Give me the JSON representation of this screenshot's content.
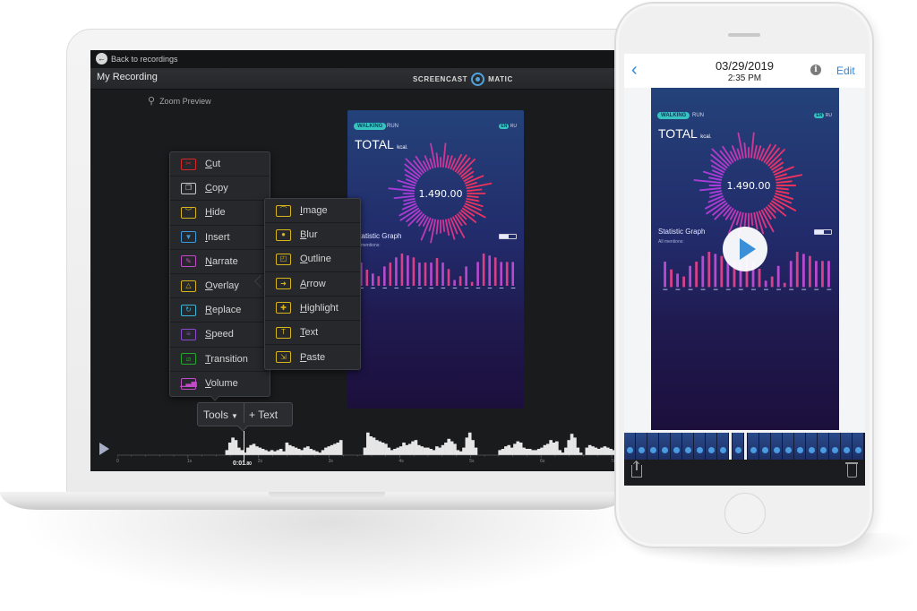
{
  "laptop": {
    "back_link": "Back to recordings",
    "recording_title": "My Recording",
    "brand_left": "SCREENCAST",
    "brand_right": "MATIC",
    "zoom_preview": "Zoom Preview",
    "tools_menu": [
      {
        "label": "Cut",
        "icon": "scissors-icon",
        "glyph": "✂",
        "color": "#d8262a"
      },
      {
        "label": "Copy",
        "icon": "copy-icon",
        "glyph": "❐",
        "color": "#c8c8c8"
      },
      {
        "label": "Hide",
        "icon": "hide-eye-icon",
        "glyph": "︶",
        "color": "#d9b51c"
      },
      {
        "label": "Insert",
        "icon": "insert-icon",
        "glyph": "▼",
        "color": "#3a9be0"
      },
      {
        "label": "Narrate",
        "icon": "microphone-icon",
        "glyph": "✎",
        "color": "#c24ac8"
      },
      {
        "label": "Overlay",
        "icon": "overlay-icon",
        "glyph": "△",
        "color": "#d9b51c"
      },
      {
        "label": "Replace",
        "icon": "replace-icon",
        "glyph": "↻",
        "color": "#38b8d8"
      },
      {
        "label": "Speed",
        "icon": "speed-icon",
        "glyph": "≡",
        "color": "#8a4ad0"
      },
      {
        "label": "Transition",
        "icon": "transition-icon",
        "glyph": "⧄",
        "color": "#22a82a"
      },
      {
        "label": "Volume",
        "icon": "volume-icon",
        "glyph": "▁▃▅",
        "color": "#c24ac8"
      }
    ],
    "overlay_submenu": [
      {
        "label": "Image",
        "icon": "image-icon",
        "glyph": "⌒",
        "color": "#d9b51c"
      },
      {
        "label": "Blur",
        "icon": "blur-icon",
        "glyph": "●",
        "color": "#d9b51c"
      },
      {
        "label": "Outline",
        "icon": "outline-icon",
        "glyph": "◰",
        "color": "#d9b51c"
      },
      {
        "label": "Arrow",
        "icon": "arrow-icon",
        "glyph": "➜",
        "color": "#d9b51c"
      },
      {
        "label": "Highlight",
        "icon": "highlight-icon",
        "glyph": "✚",
        "color": "#d9b51c"
      },
      {
        "label": "Text",
        "icon": "text-icon",
        "glyph": "T",
        "color": "#d9b51c"
      },
      {
        "label": "Paste",
        "icon": "paste-icon",
        "glyph": "⇲",
        "color": "#d9b51c"
      }
    ],
    "tools_button": "Tools",
    "add_text_button": "+ Text",
    "timeline": {
      "current_time": "0:01",
      "current_time_fraction": ".80",
      "tick_labels": [
        "0",
        "1s",
        "2s",
        "3s",
        "4s",
        "5s",
        "6s",
        "7s"
      ],
      "waveform": [
        0,
        0,
        0,
        0,
        0,
        0,
        0,
        0,
        0,
        0,
        0,
        0,
        0,
        0,
        0,
        0,
        0,
        0,
        0,
        0,
        0,
        0,
        0,
        0,
        0,
        0,
        0,
        0,
        0,
        0,
        0,
        0,
        0,
        0,
        0,
        0,
        0.2,
        0.5,
        0.7,
        0.6,
        0.3,
        0.2,
        0.1,
        0.3,
        0.4,
        0.45,
        0.35,
        0.3,
        0.25,
        0.2,
        0.15,
        0.2,
        0.15,
        0.2,
        0.25,
        0.15,
        0.5,
        0.4,
        0.35,
        0.3,
        0.25,
        0.2,
        0.3,
        0.35,
        0.25,
        0.2,
        0.15,
        0.1,
        0.2,
        0.3,
        0.35,
        0.4,
        0.45,
        0.5,
        0.6,
        0,
        0,
        0,
        0,
        0,
        0,
        0,
        0.3,
        0.9,
        0.75,
        0.7,
        0.6,
        0.55,
        0.5,
        0.45,
        0.3,
        0.2,
        0.25,
        0.3,
        0.35,
        0.5,
        0.4,
        0.45,
        0.55,
        0.6,
        0.4,
        0.35,
        0.3,
        0.3,
        0.25,
        0.2,
        0.35,
        0.3,
        0.4,
        0.5,
        0.65,
        0.55,
        0.45,
        0.2,
        0.15,
        0.3,
        0.7,
        0.9,
        0.6,
        0.3,
        0,
        0,
        0,
        0,
        0,
        0,
        0,
        0.2,
        0.25,
        0.35,
        0.4,
        0.3,
        0.45,
        0.55,
        0.5,
        0.3,
        0.25,
        0.25,
        0.2,
        0.2,
        0.25,
        0.3,
        0.4,
        0.45,
        0.6,
        0.5,
        0.55,
        0.2,
        0.1,
        0.3,
        0.6,
        0.85,
        0.7,
        0.3,
        0.1,
        0,
        0.3,
        0.4,
        0.35,
        0.3,
        0.25,
        0.3,
        0.35,
        0.3,
        0.25,
        0.2
      ]
    }
  },
  "app_preview": {
    "tab_active": "WALKING",
    "tab_inactive": "RUN",
    "lang_active": "EN",
    "lang_inactive": "RU",
    "total_label": "TOTAL",
    "unit_label": "kcal.",
    "total_value": "1.490.00",
    "graph_title": "Statistic Graph",
    "graph_subtitle": "All mentions:",
    "bar_values": [
      0.72,
      0.5,
      0.38,
      0.3,
      0.6,
      0.72,
      0.88,
      1.0,
      0.94,
      0.88,
      0.72,
      0.72,
      0.72,
      0.86,
      0.72,
      0.52,
      0.18,
      0.3,
      0.6,
      0.12,
      0.74,
      1.0,
      0.94,
      0.88,
      0.74,
      0.74,
      0.74
    ],
    "dial_rays": 64
  },
  "phone": {
    "date": "03/29/2019",
    "time": "2:35 PM",
    "edit_button": "Edit",
    "frame_count": 20,
    "selected_frame": 9
  }
}
